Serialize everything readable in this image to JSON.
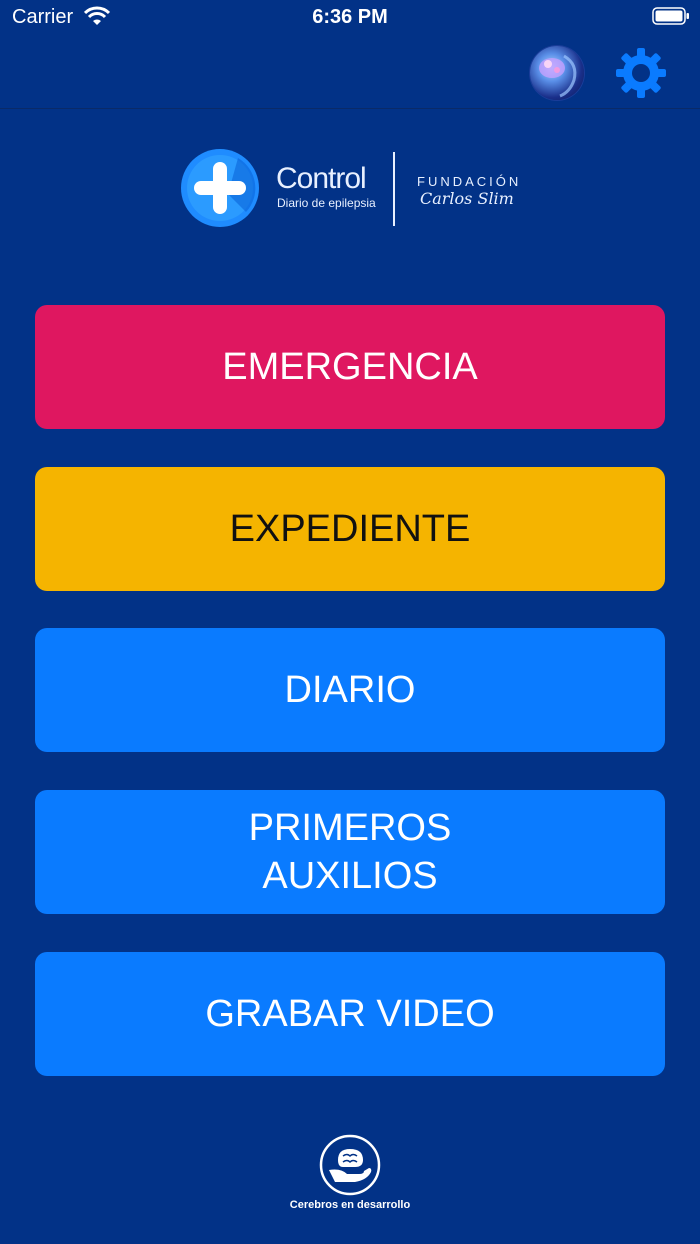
{
  "status_bar": {
    "carrier": "Carrier",
    "time": "6:36 PM"
  },
  "nav": {
    "avatar_icon": "brain-avatar-icon",
    "settings_icon": "gear-icon"
  },
  "logo": {
    "title": "Control",
    "subtitle": "Diario de epilepsia",
    "foundation_label": "FUNDACIÓN",
    "foundation_name": "Carlos Slim"
  },
  "menu": {
    "emergency": "EMERGENCIA",
    "record": "EXPEDIENTE",
    "diary": "DIARIO",
    "first_aid_line1": "PRIMEROS",
    "first_aid_line2": "AUXILIOS",
    "video": "GRABAR VIDEO"
  },
  "footer": {
    "text": "Cerebros en desarrollo"
  },
  "colors": {
    "background": "#023287",
    "emergency": "#df1760",
    "record": "#f5b400",
    "primary": "#0a7bff"
  }
}
